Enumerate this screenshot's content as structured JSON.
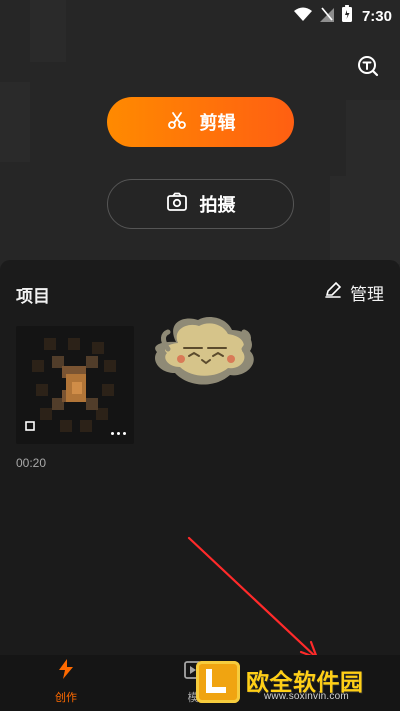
{
  "status_bar": {
    "time": "7:30"
  },
  "top_actions": {
    "primary_label": "剪辑",
    "secondary_label": "拍摄"
  },
  "projects": {
    "title": "项目",
    "manage_label": "管理",
    "items": [
      {
        "duration": "00:20"
      }
    ]
  },
  "bottom_nav": {
    "items": [
      {
        "label": "创作"
      },
      {
        "label": "模"
      }
    ]
  },
  "watermark": {
    "text": "欧全软件园",
    "url": "www.soxinvin.com"
  },
  "colors": {
    "accent_start": "#ff8a00",
    "accent_end": "#ff5f12",
    "active_nav": "#ff6a00",
    "arrow": "#ff2a2a"
  },
  "icons": {
    "top_right": "text-search-icon",
    "primary": "scissors-icon",
    "secondary": "camera-icon",
    "manage": "edit-icon",
    "nav_active": "lightning-icon"
  }
}
